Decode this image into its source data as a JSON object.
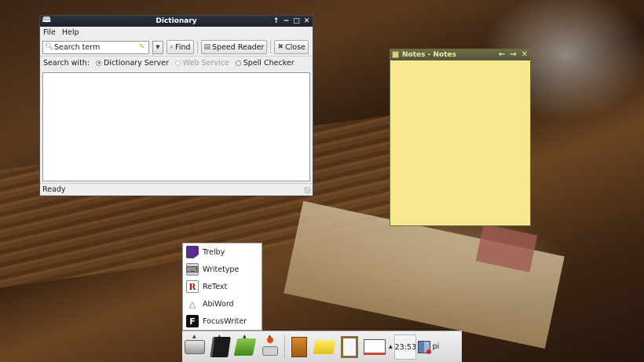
{
  "dictionary": {
    "title": "Dictionary",
    "menu": [
      "File",
      "Help"
    ],
    "search_placeholder": "Search term",
    "buttons": {
      "find": "Find",
      "speed_reader": "Speed Reader",
      "close": "Close"
    },
    "search_with_label": "Search with:",
    "sources": [
      {
        "label": "Dictionary Server",
        "selected": true,
        "enabled": true
      },
      {
        "label": "Web Service",
        "selected": false,
        "enabled": false
      },
      {
        "label": "Spell Checker",
        "selected": false,
        "enabled": true
      }
    ],
    "status": "Ready"
  },
  "notes": {
    "title": "Notes - Notes"
  },
  "launcher_menu": {
    "items": [
      {
        "label": "Trelby",
        "icon": "trelby-icon"
      },
      {
        "label": "Writetype",
        "icon": "writetype-icon"
      },
      {
        "label": "ReText",
        "icon": "retext-icon"
      },
      {
        "label": "AbiWord",
        "icon": "abiword-icon"
      },
      {
        "label": "FocusWriter",
        "icon": "focuswriter-icon"
      }
    ]
  },
  "taskbar": {
    "launchers": [
      "scanner-icon",
      "black-book-icon",
      "green-book-icon",
      "joystick-icon",
      "file-cabinet-icon",
      "folder-icon",
      "clipboard-icon",
      "open-book-icon"
    ],
    "clock": "23:53",
    "user": "pi"
  }
}
